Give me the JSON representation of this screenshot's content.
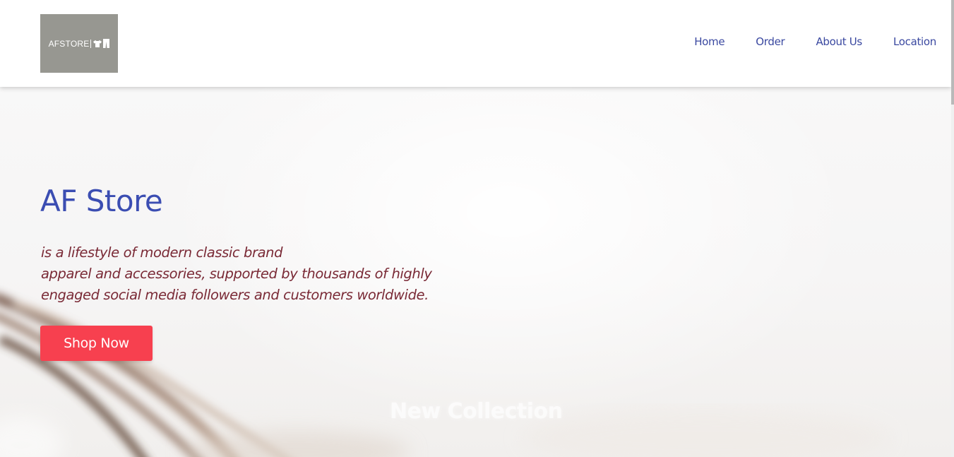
{
  "brand": {
    "logo_text": "AFSTORE"
  },
  "nav": {
    "items": [
      {
        "label": "Home"
      },
      {
        "label": "Order"
      },
      {
        "label": "About Us"
      },
      {
        "label": "Location"
      }
    ]
  },
  "hero": {
    "title": "AF Store",
    "description_lines": [
      "is a lifestyle of modern classic brand",
      "apparel and accessories, supported by thousands of highly",
      "engaged social media followers and customers worldwide."
    ],
    "cta_label": "Shop Now"
  },
  "section": {
    "heading": "New Collection"
  },
  "colors": {
    "accent": "#3b4db2",
    "nav_text": "#3a48a0",
    "description": "#7a2a36",
    "button": "#f7404f",
    "logo_bg": "#979791"
  }
}
